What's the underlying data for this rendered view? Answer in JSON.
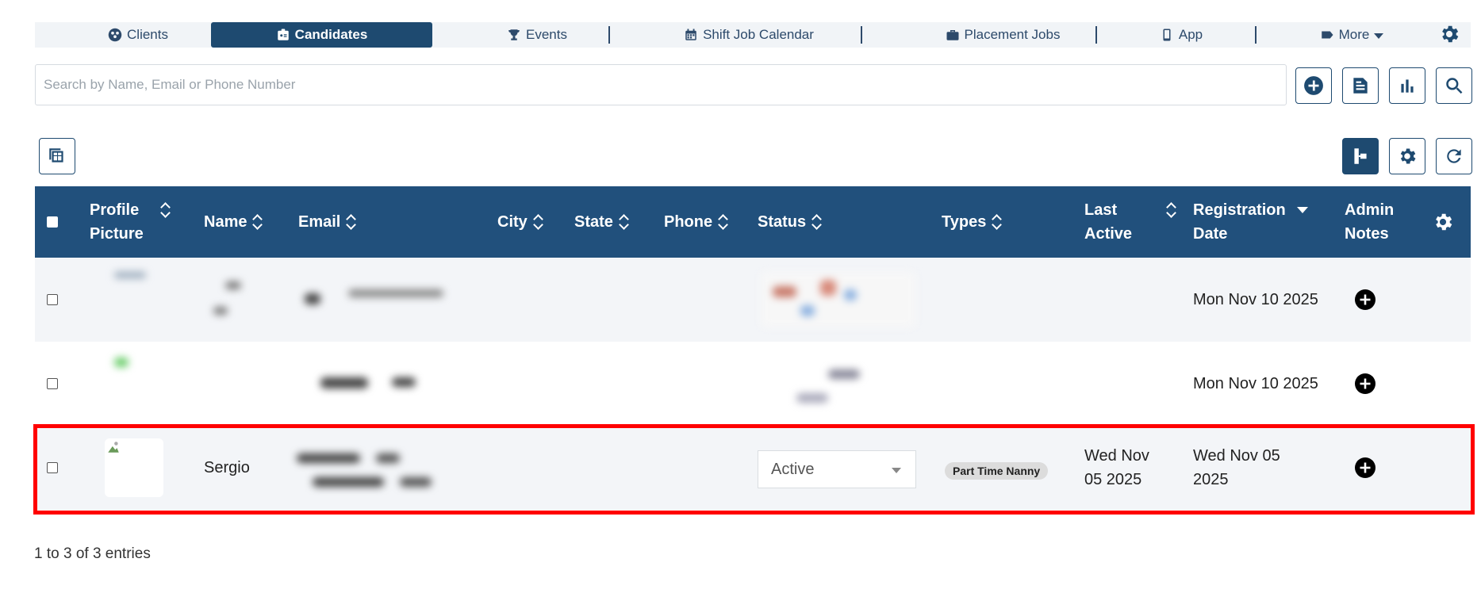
{
  "nav": {
    "clients": "Clients",
    "candidates": "Candidates",
    "events": "Events",
    "shift_job_calendar": "Shift Job Calendar",
    "placement_jobs": "Placement Jobs",
    "app": "App",
    "more": "More"
  },
  "search": {
    "placeholder": "Search by Name, Email or Phone Number"
  },
  "table": {
    "headers": {
      "profile_picture_1": "Profile",
      "profile_picture_2": "Picture",
      "name": "Name",
      "email": "Email",
      "city": "City",
      "state": "State",
      "phone": "Phone",
      "status": "Status",
      "types": "Types",
      "last_active_1": "Last",
      "last_active_2": "Active",
      "registration_date_1": "Registration",
      "registration_date_2": "Date",
      "admin_notes_1": "Admin",
      "admin_notes_2": "Notes"
    },
    "rows": [
      {
        "registration_date": "Mon Nov 10 2025"
      },
      {
        "registration_date": "Mon Nov 10 2025"
      },
      {
        "name": "Sergio",
        "status": "Active",
        "type": "Part Time Nanny",
        "last_active_1": "Wed Nov",
        "last_active_2": "05 2025",
        "registration_date_1": "Wed Nov 05",
        "registration_date_2": "2025"
      }
    ]
  },
  "footer": {
    "entries_info": "1 to 3 of 3 entries"
  },
  "colors": {
    "primary": "#1e4a70",
    "header_bg": "#21507c",
    "highlight": "#ff0000"
  }
}
